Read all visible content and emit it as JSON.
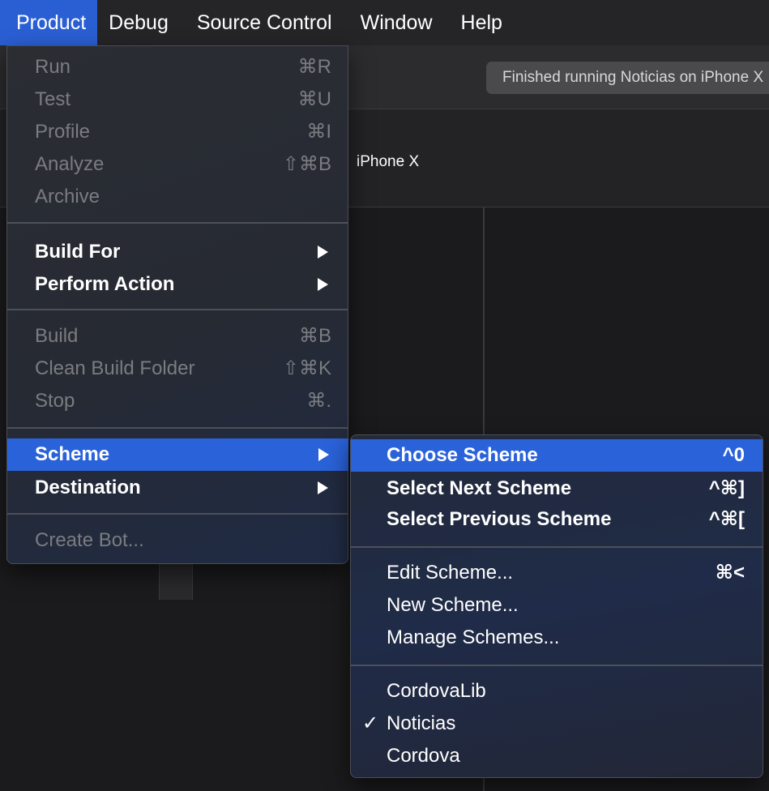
{
  "menubar": {
    "items": [
      "Product",
      "Debug",
      "Source Control",
      "Window",
      "Help"
    ]
  },
  "toolbar": {
    "status_text": "Finished running Noticias on iPhone X"
  },
  "tabbar": {
    "device": "iPhone X"
  },
  "product_menu": {
    "run": {
      "label": "Run",
      "shortcut": "⌘R"
    },
    "test": {
      "label": "Test",
      "shortcut": "⌘U"
    },
    "profile": {
      "label": "Profile",
      "shortcut": "⌘I"
    },
    "analyze": {
      "label": "Analyze",
      "shortcut": "⇧⌘B"
    },
    "archive": {
      "label": "Archive"
    },
    "build_for": {
      "label": "Build For"
    },
    "perform_action": {
      "label": "Perform Action"
    },
    "build": {
      "label": "Build",
      "shortcut": "⌘B"
    },
    "clean_build_folder": {
      "label": "Clean Build Folder",
      "shortcut": "⇧⌘K"
    },
    "stop": {
      "label": "Stop",
      "shortcut": "⌘."
    },
    "scheme": {
      "label": "Scheme"
    },
    "destination": {
      "label": "Destination"
    },
    "create_bot": {
      "label": "Create Bot..."
    }
  },
  "scheme_menu": {
    "choose_scheme": {
      "label": "Choose Scheme",
      "shortcut": "^0"
    },
    "select_next_scheme": {
      "label": "Select Next Scheme",
      "shortcut": "^⌘]"
    },
    "select_previous_scheme": {
      "label": "Select Previous Scheme",
      "shortcut": "^⌘["
    },
    "edit_scheme": {
      "label": "Edit Scheme...",
      "shortcut": "⌘<"
    },
    "new_scheme": {
      "label": "New Scheme..."
    },
    "manage_schemes": {
      "label": "Manage Schemes..."
    },
    "schemes": [
      "CordovaLib",
      "Noticias",
      "Cordova"
    ],
    "checkmark": "✓"
  }
}
